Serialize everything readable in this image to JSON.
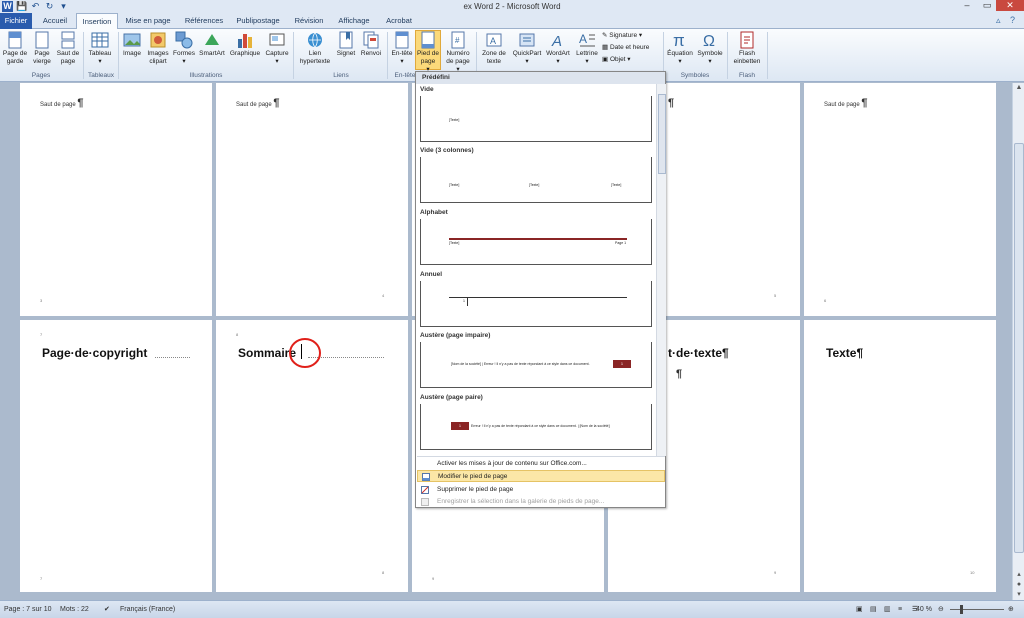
{
  "window": {
    "title": "ex Word 2 - Microsoft Word"
  },
  "quick_access": [
    "W",
    "save",
    "undo",
    "redo"
  ],
  "tabs": [
    "Fichier",
    "Accueil",
    "Insertion",
    "Mise en page",
    "Références",
    "Publipostage",
    "Révision",
    "Affichage",
    "Acrobat"
  ],
  "ribbon": {
    "buttons": {
      "page_garde": "Page de garde",
      "page_vierge": "Page vierge",
      "saut_page": "Saut de page",
      "tableau": "Tableau",
      "image": "Image",
      "images_clipart": "Images clipart",
      "formes": "Formes",
      "smartart": "SmartArt",
      "graphique": "Graphique",
      "capture": "Capture",
      "lien_hypertexte": "Lien hypertexte",
      "signet": "Signet",
      "renvoi": "Renvoi",
      "en_tete": "En-tête",
      "pied_page": "Pied de page",
      "numero_page": "Numéro de page",
      "zone_texte": "Zone de texte",
      "quickpart": "QuickPart",
      "wordart": "WordArt",
      "lettrine": "Lettrine",
      "signature": "Signature",
      "date_heure": "Date et heure",
      "objet": "Objet",
      "equation": "Équation",
      "symbole": "Symbole",
      "flash": "Flash einbetten"
    },
    "groups": {
      "pages": "Pages",
      "tableaux": "Tableaux",
      "illustrations": "Illustrations",
      "liens": "Liens",
      "en_tete_partial": "En-tête",
      "symboles": "Symboles",
      "flash": "Flash"
    }
  },
  "gallery": {
    "header": "Prédéfini",
    "items": [
      {
        "name": "Vide",
        "texts": [
          "[Texte]"
        ]
      },
      {
        "name": "Vide (3 colonnes)",
        "texts": [
          "[Texte]",
          "[Texte]",
          "[Texte]"
        ]
      },
      {
        "name": "Alphabet",
        "texts": [
          "[Texte]",
          "Page 1"
        ]
      },
      {
        "name": "Annuel",
        "texts": [
          "1"
        ]
      },
      {
        "name": "Austère (page impaire)",
        "texts": [
          "[Nom de la société] | Erreur ! Il n'y a pas de texte répondant à ce style dans ce document.",
          "1"
        ]
      },
      {
        "name": "Austère (page paire)",
        "texts": [
          "1",
          "Erreur ! Il n'y a pas de texte répondant à ce style dans ce document. | [Nom de la société]"
        ]
      }
    ],
    "menu": [
      {
        "label": "Activer les mises à jour de contenu sur Office.com...",
        "state": "normal"
      },
      {
        "label": "Modifier le pied de page",
        "state": "hover"
      },
      {
        "label": "Supprimer le pied de page",
        "state": "normal"
      },
      {
        "label": "Enregistrer la sélection dans la galerie de pieds de page...",
        "state": "disabled"
      }
    ]
  },
  "document": {
    "saut_label": "Saut de page",
    "pilcrow": "¶",
    "headings": {
      "copyright": "Page·de·copyright",
      "sommaire": "Sommaire",
      "partial": "t·de·texte¶",
      "texte": "Texte¶"
    },
    "page_numbers": {
      "p3": "3",
      "p4": "4",
      "p5": "5",
      "p6": "6",
      "p7": "7",
      "p8": "8",
      "p9": "9",
      "p10": "10"
    }
  },
  "status": {
    "page": "Page : 7 sur 10",
    "words": "Mots : 22",
    "language": "Français (France)",
    "zoom": "40 %"
  },
  "colors": {
    "file_tab": "#2a5cad",
    "hover": "#fbe7a7",
    "highlight_circle": "#e0201a"
  }
}
